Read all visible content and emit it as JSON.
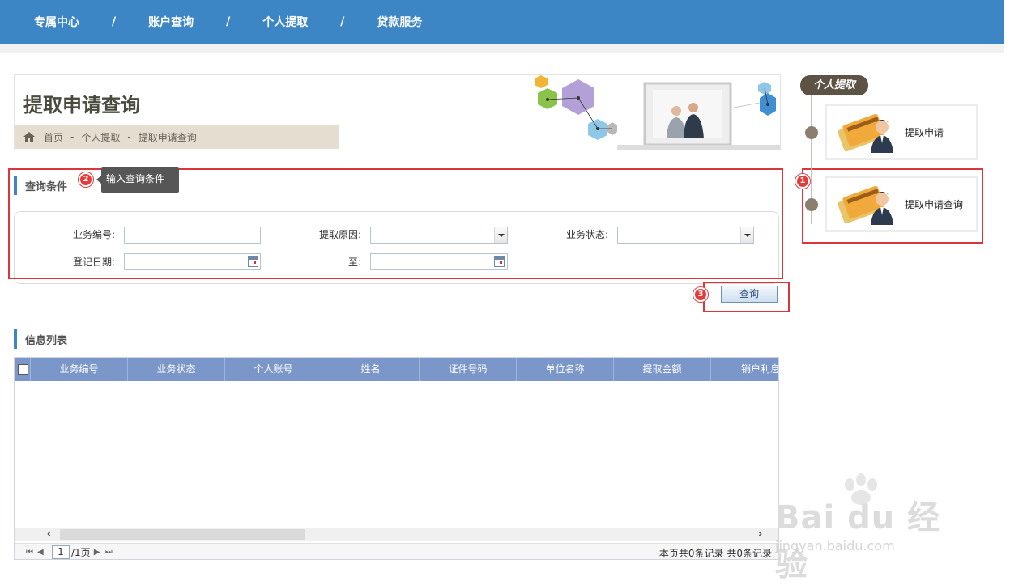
{
  "nav": {
    "items": [
      "专属中心",
      "账户查询",
      "个人提取",
      "贷款服务"
    ],
    "separator": "/"
  },
  "banner": {
    "title": "提取申请查询",
    "breadcrumb": [
      "首页",
      "个人提取",
      "提取申请查询"
    ],
    "breadcrumb_sep": "-"
  },
  "query": {
    "section_title": "查询条件",
    "fields": {
      "business_no": {
        "label": "业务编号:",
        "value": ""
      },
      "reason": {
        "label": "提取原因:",
        "value": ""
      },
      "status": {
        "label": "业务状态:",
        "value": ""
      },
      "reg_date": {
        "label": "登记日期:",
        "value": ""
      },
      "to": {
        "label": "至:",
        "value": ""
      }
    },
    "button": "查询"
  },
  "annotations": {
    "badge1": "1",
    "badge2": "2",
    "badge3": "3",
    "tooltip": "输入查询条件"
  },
  "list": {
    "section_title": "信息列表",
    "columns": [
      "业务编号",
      "业务状态",
      "个人账号",
      "姓名",
      "证件号码",
      "单位名称",
      "提取金额",
      "销户利息"
    ],
    "rows": [],
    "pager": {
      "current": "1",
      "total": "/1页",
      "summary": "本页共0条记录  共0条记录"
    }
  },
  "side": {
    "title": "个人提取",
    "items": [
      {
        "label": "提取申请"
      },
      {
        "label": "提取申请查询"
      }
    ]
  },
  "watermark": {
    "big": "Bai du 经验",
    "small": "jingyan.baidu.com"
  },
  "colors": {
    "nav_bg": "#3d86c6",
    "header_bg": "#7b96c8",
    "accent_red": "#d9363e",
    "side_title_bg": "#5d5345"
  }
}
